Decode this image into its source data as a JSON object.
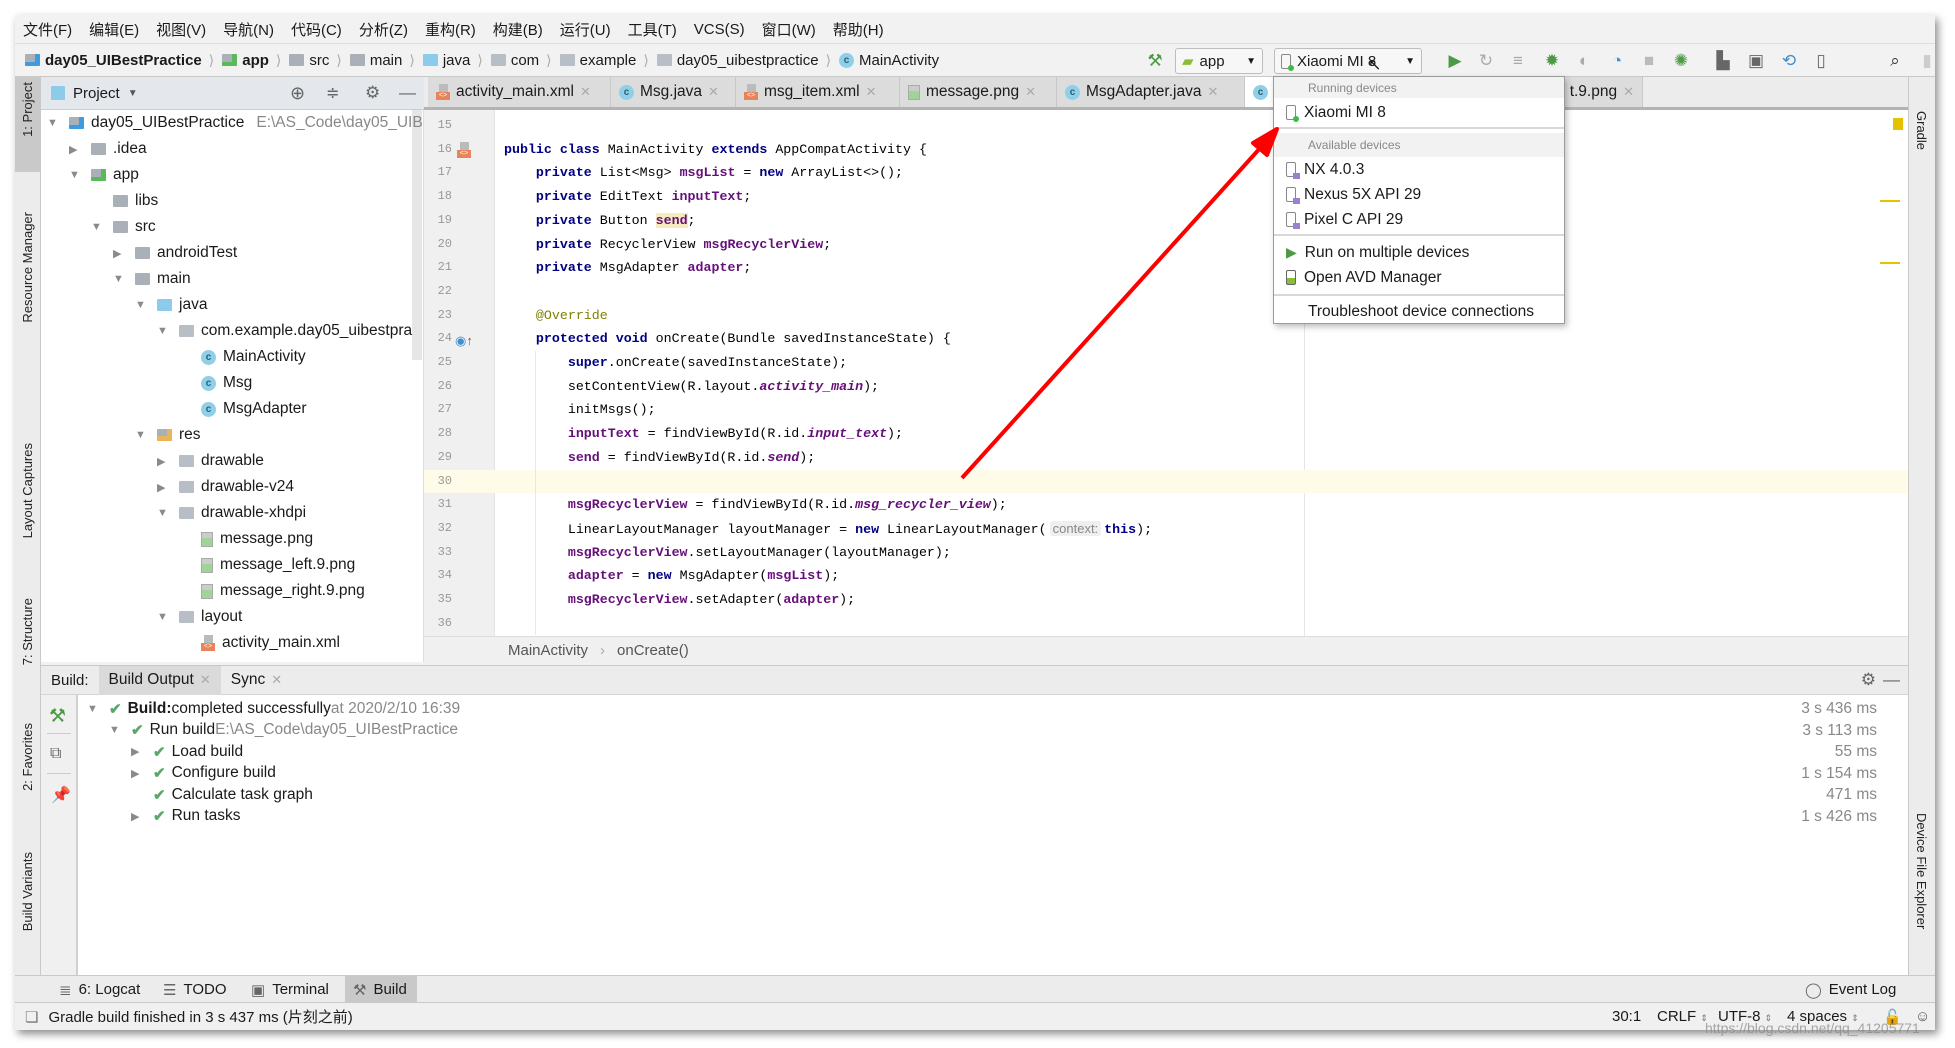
{
  "menu": [
    "文件(F)",
    "编辑(E)",
    "视图(V)",
    "导航(N)",
    "代码(C)",
    "分析(Z)",
    "重构(R)",
    "构建(B)",
    "运行(U)",
    "工具(T)",
    "VCS(S)",
    "窗口(W)",
    "帮助(H)"
  ],
  "breadcrumb": [
    {
      "label": "day05_UIBestPractice",
      "icon": "project-folder-icon",
      "bold": true
    },
    {
      "label": "app",
      "icon": "module-folder-icon",
      "bold": true
    },
    {
      "label": "src",
      "icon": "folder-icon"
    },
    {
      "label": "main",
      "icon": "folder-icon"
    },
    {
      "label": "java",
      "icon": "source-folder-icon"
    },
    {
      "label": "com",
      "icon": "package-icon"
    },
    {
      "label": "example",
      "icon": "package-icon"
    },
    {
      "label": "day05_uibestpractice",
      "icon": "package-icon"
    },
    {
      "label": "MainActivity",
      "icon": "class-icon"
    }
  ],
  "toolbar": {
    "config": "app",
    "device": "Xiaomi MI 8",
    "icons": [
      "run-icon",
      "apply-changes-icon",
      "apply-code-changes-icon",
      "debug-icon",
      "profile-icon",
      "attach-debugger-icon",
      "stop-icon",
      "sync-project-icon",
      "layout-inspector-icon",
      "avd-manager-icon",
      "sdk-manager-icon",
      "plugin-icon",
      "search-icon",
      "account-icon"
    ]
  },
  "left_stripe": [
    "1: Project",
    "Resource Manager",
    "Layout Captures",
    "7: Structure",
    "2: Favorites",
    "Build Variants"
  ],
  "right_stripe": [
    "Gradle",
    "Device File Explorer"
  ],
  "project": {
    "title": "Project",
    "tree": [
      {
        "d": 0,
        "a": "open",
        "icon": "project",
        "label": "day05_UIBestPractice",
        "extra": "E:\\AS_Code\\day05_UIB"
      },
      {
        "d": 1,
        "a": "closed",
        "icon": "folder",
        "label": ".idea"
      },
      {
        "d": 1,
        "a": "open",
        "icon": "module",
        "label": "app"
      },
      {
        "d": 2,
        "a": "none",
        "icon": "folder",
        "label": "libs"
      },
      {
        "d": 2,
        "a": "open",
        "icon": "folder",
        "label": "src"
      },
      {
        "d": 3,
        "a": "closed",
        "icon": "folder",
        "label": "androidTest"
      },
      {
        "d": 3,
        "a": "open",
        "icon": "folder",
        "label": "main"
      },
      {
        "d": 4,
        "a": "open",
        "icon": "srcfolder",
        "label": "java"
      },
      {
        "d": 5,
        "a": "open",
        "icon": "package",
        "label": "com.example.day05_uibestpra"
      },
      {
        "d": 6,
        "a": "none",
        "icon": "class",
        "label": "MainActivity"
      },
      {
        "d": 6,
        "a": "none",
        "icon": "class",
        "label": "Msg"
      },
      {
        "d": 6,
        "a": "none",
        "icon": "class",
        "label": "MsgAdapter"
      },
      {
        "d": 4,
        "a": "open",
        "icon": "res",
        "label": "res"
      },
      {
        "d": 5,
        "a": "closed",
        "icon": "package",
        "label": "drawable"
      },
      {
        "d": 5,
        "a": "closed",
        "icon": "package",
        "label": "drawable-v24"
      },
      {
        "d": 5,
        "a": "open",
        "icon": "package",
        "label": "drawable-xhdpi"
      },
      {
        "d": 6,
        "a": "none",
        "icon": "image",
        "label": "message.png"
      },
      {
        "d": 6,
        "a": "none",
        "icon": "image",
        "label": "message_left.9.png"
      },
      {
        "d": 6,
        "a": "none",
        "icon": "image",
        "label": "message_right.9.png"
      },
      {
        "d": 5,
        "a": "open",
        "icon": "package",
        "label": "layout"
      },
      {
        "d": 6,
        "a": "none",
        "icon": "xml",
        "label": "activity_main.xml"
      }
    ]
  },
  "tabs": [
    {
      "label": "activity_main.xml",
      "icon": "xml"
    },
    {
      "label": "Msg.java",
      "icon": "class"
    },
    {
      "label": "msg_item.xml",
      "icon": "xml"
    },
    {
      "label": "message.png",
      "icon": "image"
    },
    {
      "label": "MsgAdapter.java",
      "icon": "class"
    },
    {
      "label": "",
      "icon": "class",
      "active": true
    },
    {
      "label": "t.9.png",
      "icon": "image"
    }
  ],
  "code": {
    "first_line": 15,
    "current_line": 30,
    "lines": [
      [],
      [
        [
          "kw",
          "public class"
        ],
        [
          "p",
          " MainActivity "
        ],
        [
          "kw",
          "extends"
        ],
        [
          "p",
          " AppCompatActivity {"
        ]
      ],
      [
        [
          "p",
          "    "
        ],
        [
          "kw",
          "private"
        ],
        [
          "p",
          " List<Msg> "
        ],
        [
          "field",
          "msgList"
        ],
        [
          "p",
          " = "
        ],
        [
          "kw",
          "new"
        ],
        [
          "p",
          " ArrayList<>();"
        ]
      ],
      [
        [
          "p",
          "    "
        ],
        [
          "kw",
          "private"
        ],
        [
          "p",
          " EditText "
        ],
        [
          "field",
          "inputText"
        ],
        [
          "p",
          ";"
        ]
      ],
      [
        [
          "p",
          "    "
        ],
        [
          "kw",
          "private"
        ],
        [
          "p",
          " Button "
        ],
        [
          "fieldhl",
          "send"
        ],
        [
          "p",
          ";"
        ]
      ],
      [
        [
          "p",
          "    "
        ],
        [
          "kw",
          "private"
        ],
        [
          "p",
          " RecyclerView "
        ],
        [
          "field",
          "msgRecyclerView"
        ],
        [
          "p",
          ";"
        ]
      ],
      [
        [
          "p",
          "    "
        ],
        [
          "kw",
          "private"
        ],
        [
          "p",
          " MsgAdapter "
        ],
        [
          "field",
          "adapter"
        ],
        [
          "p",
          ";"
        ]
      ],
      [],
      [
        [
          "p",
          "    "
        ],
        [
          "ann",
          "@Override"
        ]
      ],
      [
        [
          "p",
          "    "
        ],
        [
          "kw",
          "protected void"
        ],
        [
          "p",
          " onCreate(Bundle savedInstanceState) {"
        ]
      ],
      [
        [
          "p",
          "        "
        ],
        [
          "kw",
          "super"
        ],
        [
          "p",
          ".onCreate(savedInstanceState);"
        ]
      ],
      [
        [
          "p",
          "        setContentView(R.layout."
        ],
        [
          "sf",
          "activity_main"
        ],
        [
          "p",
          ");"
        ]
      ],
      [
        [
          "p",
          "        initMsgs();"
        ]
      ],
      [
        [
          "p",
          "        "
        ],
        [
          "field",
          "inputText"
        ],
        [
          "p",
          " = findViewById(R.id."
        ],
        [
          "sf",
          "input_text"
        ],
        [
          "p",
          ");"
        ]
      ],
      [
        [
          "p",
          "        "
        ],
        [
          "field",
          "send"
        ],
        [
          "p",
          " = findViewById(R.id."
        ],
        [
          "sf",
          "send"
        ],
        [
          "p",
          ");"
        ]
      ],
      [],
      [
        [
          "p",
          "        "
        ],
        [
          "field",
          "msgRecyclerView"
        ],
        [
          "p",
          " = findViewById(R.id."
        ],
        [
          "sf",
          "msg_recycler_view"
        ],
        [
          "p",
          ");"
        ]
      ],
      [
        [
          "p",
          "        LinearLayoutManager layoutManager = "
        ],
        [
          "kw",
          "new"
        ],
        [
          "p",
          " LinearLayoutManager("
        ],
        [
          "hint",
          "context:"
        ],
        [
          "kw",
          "this"
        ],
        [
          "p",
          ");"
        ]
      ],
      [
        [
          "p",
          "        "
        ],
        [
          "field",
          "msgRecyclerView"
        ],
        [
          "p",
          ".setLayoutManager(layoutManager);"
        ]
      ],
      [
        [
          "p",
          "        "
        ],
        [
          "field",
          "adapter"
        ],
        [
          "p",
          " = "
        ],
        [
          "kw",
          "new"
        ],
        [
          "p",
          " MsgAdapter("
        ],
        [
          "field",
          "msgList"
        ],
        [
          "p",
          ");"
        ]
      ],
      [
        [
          "p",
          "        "
        ],
        [
          "field",
          "msgRecyclerView"
        ],
        [
          "p",
          ".setAdapter("
        ],
        [
          "field",
          "adapter"
        ],
        [
          "p",
          ");"
        ]
      ],
      []
    ]
  },
  "editor_crumb": [
    "MainActivity",
    "onCreate()"
  ],
  "device_dropdown": {
    "running_header": "Running devices",
    "running": [
      "Xiaomi MI 8"
    ],
    "available_header": "Available devices",
    "available": [
      "NX 4.0.3",
      "Nexus 5X API 29",
      "Pixel C API 29"
    ],
    "actions": [
      "Run on multiple devices",
      "Open AVD Manager"
    ],
    "troubleshoot": "Troubleshoot device connections"
  },
  "build": {
    "label": "Build:",
    "tabs": [
      "Build Output",
      "Sync"
    ],
    "rows": [
      {
        "d": 0,
        "a": "open",
        "bold": "Build:",
        "label": " completed successfully",
        "extra": " at 2020/2/10 16:39",
        "time": "3 s 436 ms"
      },
      {
        "d": 1,
        "a": "open",
        "label": "Run build",
        "extra": " E:\\AS_Code\\day05_UIBestPractice",
        "time": "3 s 113 ms"
      },
      {
        "d": 2,
        "a": "closed",
        "label": "Load build",
        "time": "55 ms"
      },
      {
        "d": 2,
        "a": "closed",
        "label": "Configure build",
        "time": "1 s 154 ms"
      },
      {
        "d": 2,
        "a": "none",
        "label": "Calculate task graph",
        "time": "471 ms"
      },
      {
        "d": 2,
        "a": "closed",
        "label": "Run tasks",
        "time": "1 s 426 ms"
      }
    ]
  },
  "bottom_tabs": [
    "6: Logcat",
    "TODO",
    "Terminal",
    "Build"
  ],
  "event_log": "Event Log",
  "status": {
    "message": "Gradle build finished in 3 s 437 ms (片刻之前)",
    "position": "30:1",
    "line_sep": "CRLF",
    "encoding": "UTF-8",
    "indent": "4 spaces"
  },
  "watermark": "https://blog.csdn.net/qq_41205771",
  "colors": {
    "keyword": "#000080",
    "field": "#660e7a",
    "annotation": "#808000",
    "success": "#59a869",
    "arrow": "#ff0000"
  }
}
